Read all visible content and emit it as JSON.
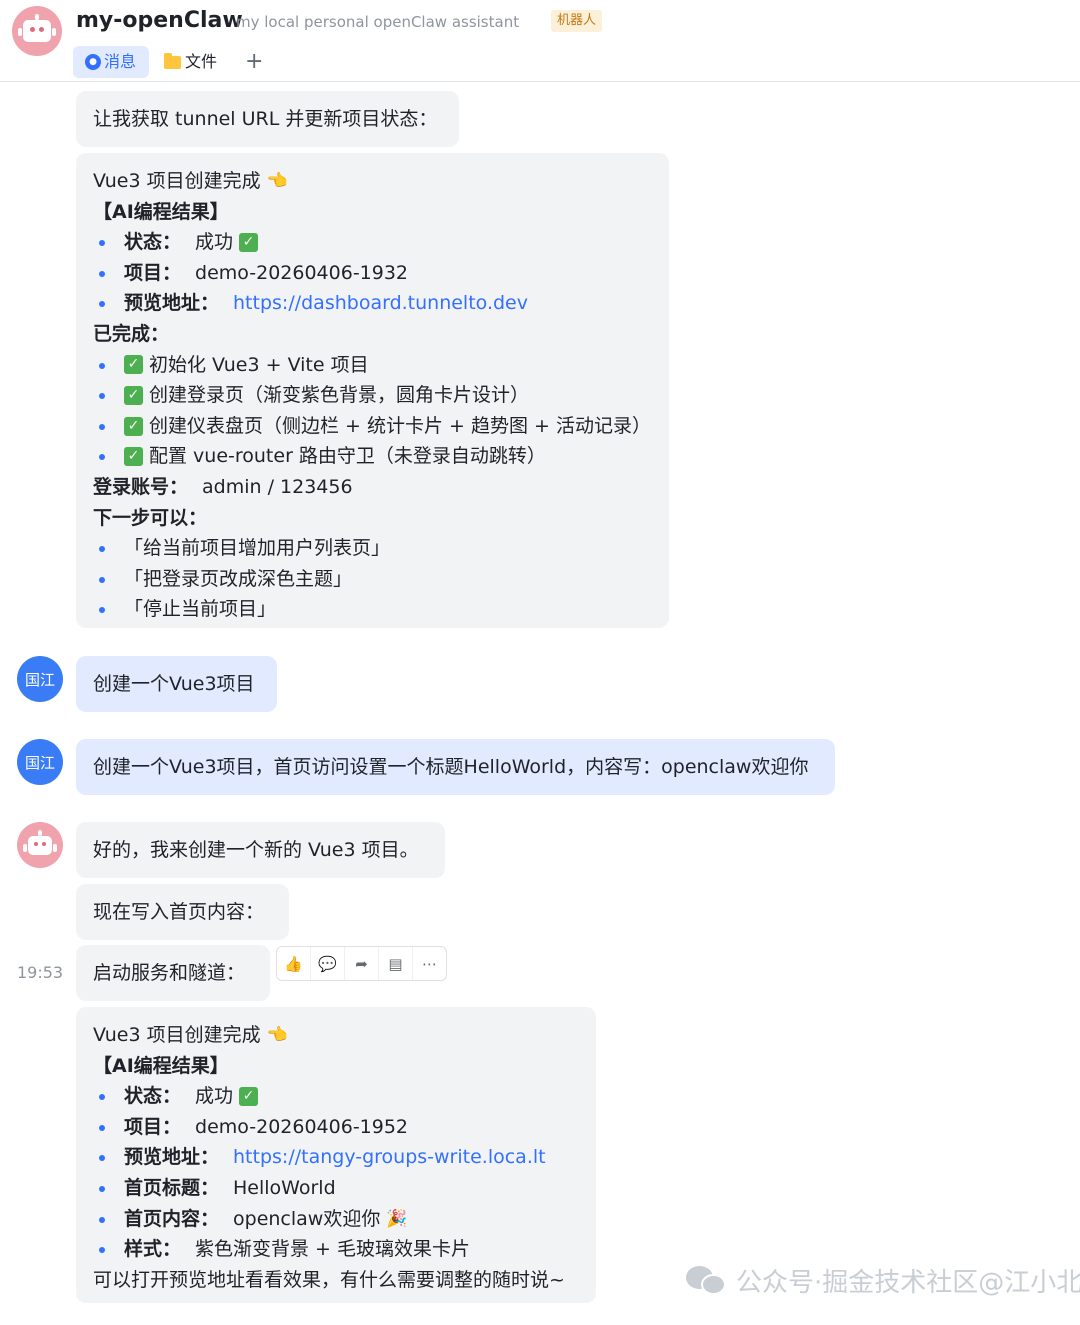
{
  "header": {
    "title": "my-openClaw",
    "subtitle": "my local personal openClaw assistant",
    "badge": "机器人",
    "tabs": {
      "messages": "消息",
      "files": "文件",
      "add": "+"
    }
  },
  "messages": {
    "m1": "让我获取 tunnel URL 并更新项目状态：",
    "card1": {
      "title": "Vue3 项目创建完成",
      "section": "【AI编程结果】",
      "status_label": "状态：",
      "status_value": "成功",
      "project_label": "项目：",
      "project_value": "demo-20260406-1932",
      "preview_label": "预览地址：",
      "preview_value": "https://dashboard.tunnelto.dev",
      "done_label": "已完成：",
      "done": [
        "初始化 Vue3 + Vite 项目",
        "创建登录页（渐变紫色背景，圆角卡片设计）",
        "创建仪表盘页（侧边栏 + 统计卡片 + 趋势图 + 活动记录）",
        "配置 vue-router 路由守卫（未登录自动跳转）"
      ],
      "account_label": "登录账号：",
      "account_value": "admin / 123456",
      "next_label": "下一步可以：",
      "next": [
        "「给当前项目增加用户列表页」",
        "「把登录页改成深色主题」",
        "「停止当前项目」"
      ]
    },
    "user_avatar": "国江",
    "u1": "创建一个Vue3项目",
    "u2": "创建一个Vue3项目，首页访问设置一个标题HelloWorld，内容写：openclaw欢迎你",
    "b1": "好的，我来创建一个新的 Vue3 项目。",
    "b2": "现在写入首页内容：",
    "time": "19:53",
    "b3": "启动服务和隧道：",
    "card2": {
      "title": "Vue3 项目创建完成",
      "section": "【AI编程结果】",
      "status_label": "状态：",
      "status_value": "成功",
      "project_label": "项目：",
      "project_value": "demo-20260406-1952",
      "preview_label": "预览地址：",
      "preview_value": "https://tangy-groups-write.loca.lt",
      "hp_title_label": "首页标题：",
      "hp_title_value": "HelloWorld",
      "hp_content_label": "首页内容：",
      "hp_content_value": "openclaw欢迎你",
      "style_label": "样式：",
      "style_value": "紫色渐变背景 + 毛玻璃效果卡片",
      "footer": "可以打开预览地址看看效果，有什么需要调整的随时说~"
    }
  },
  "watermark": "公众号·掘金技术社区@江小北",
  "colors": {
    "accent": "#3370ff",
    "bubble": "#f2f3f5",
    "user_bubble": "#e1eaff",
    "bot_avatar": "#f0a2ad",
    "user_avatar": "#3a7cf6"
  }
}
